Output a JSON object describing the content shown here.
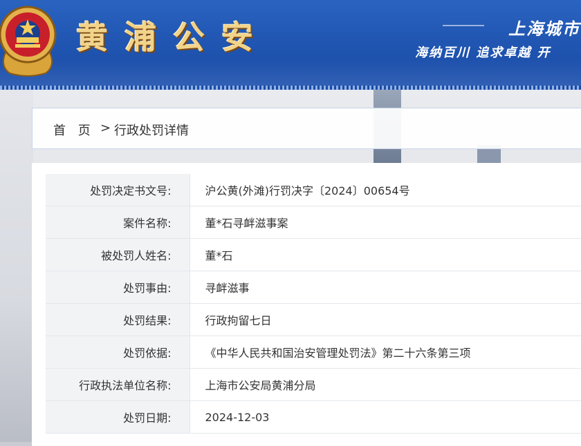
{
  "header": {
    "site_title": "黄浦公安",
    "city_slogan": "上海城市",
    "motto": "海纳百川 追求卓越 开"
  },
  "breadcrumb": {
    "home": "首 页",
    "separator": ">",
    "current": "行政处罚详情"
  },
  "details": {
    "rows": [
      {
        "label": "处罚决定书文号:",
        "value": "沪公黄(外滩)行罚决字〔2024〕00654号"
      },
      {
        "label": "案件名称:",
        "value": "董*石寻衅滋事案"
      },
      {
        "label": "被处罚人姓名:",
        "value": "董*石"
      },
      {
        "label": "处罚事由:",
        "value": "寻衅滋事"
      },
      {
        "label": "处罚结果:",
        "value": "行政拘留七日"
      },
      {
        "label": "处罚依据:",
        "value": "《中华人民共和国治安管理处罚法》第二十六条第三项"
      },
      {
        "label": "行政执法单位名称:",
        "value": "上海市公安局黄浦分局"
      },
      {
        "label": "处罚日期:",
        "value": "2024-12-03"
      }
    ]
  },
  "colors": {
    "header_blue": "#1f54b0",
    "title_gold": "#f2d38a",
    "label_bg": "#f2f3f5"
  },
  "icons": {
    "emblem": "police-emblem-icon"
  }
}
